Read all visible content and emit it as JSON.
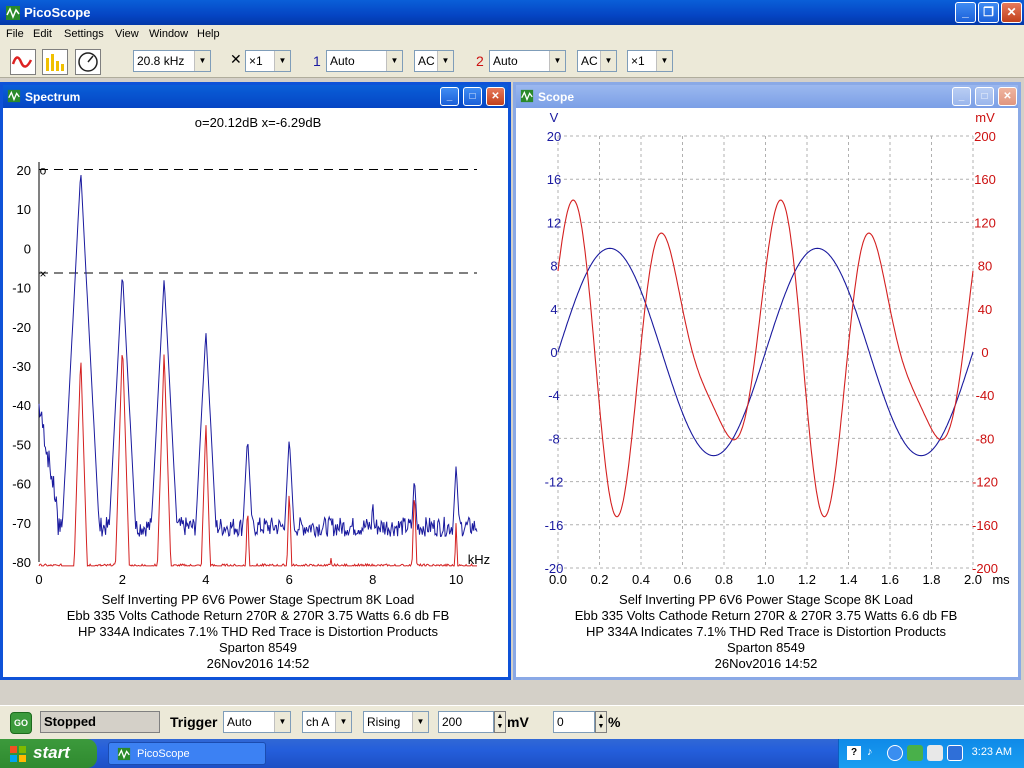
{
  "app": {
    "title": "PicoScope"
  },
  "menu": [
    "File",
    "Edit",
    "Settings",
    "View",
    "Window",
    "Help"
  ],
  "toolbar": {
    "timebase": "20.8 kHz",
    "x_mult": "×1",
    "ch1_label": "1",
    "ch1_range": "Auto",
    "ch1_coupling": "AC",
    "ch2_label": "2",
    "ch2_range": "Auto",
    "ch2_coupling": "AC",
    "ch2_mult": "×1"
  },
  "spectrum": {
    "title": "Spectrum",
    "readout": "o=20.12dB  x=-6.29dB",
    "x_unit": "kHz",
    "caption": [
      "Self Inverting PP 6V6 Power Stage Spectrum 8K Load",
      "Ebb 335 Volts Cathode Return 270R & 270R 3.75 Watts 6.6 db FB",
      "HP 334A Indicates 7.1% THD Red Trace is Distortion Products",
      "Sparton 8549",
      "26Nov2016  14:52"
    ]
  },
  "scope": {
    "title": "Scope",
    "y_left_unit": "V",
    "y_right_unit": "mV",
    "x_unit": "ms",
    "caption": [
      "Self Inverting PP 6V6 Power Stage Scope 8K Load",
      "Ebb 335 Volts Cathode Return 270R & 270R 3.75 Watts 6.6 db FB",
      "HP 334A Indicates 7.1% THD Red Trace is Distortion Products",
      "Sparton 8549",
      "26Nov2016  14:52"
    ]
  },
  "chart_data": [
    {
      "type": "line",
      "x_ticks": [
        0,
        2,
        4,
        6,
        8,
        10
      ],
      "y_ticks": [
        20,
        10,
        0,
        -10,
        -20,
        -30,
        -40,
        -50,
        -60,
        -70,
        -80
      ],
      "xlim": [
        0,
        10.5
      ],
      "ylim": [
        -80,
        20
      ],
      "cursor_levels": [
        20.12,
        -6.29
      ],
      "series": [
        {
          "color": "#1a1a9e",
          "peaks": [
            {
              "x": 1,
              "y": 20
            },
            {
              "x": 2,
              "y": -6
            },
            {
              "x": 3,
              "y": -7.5
            },
            {
              "x": 4,
              "y": -21
            },
            {
              "x": 5,
              "y": -48
            },
            {
              "x": 6,
              "y": -48
            },
            {
              "x": 7,
              "y": -69
            },
            {
              "x": 8,
              "y": -64
            },
            {
              "x": 9,
              "y": -58
            },
            {
              "x": 10,
              "y": -55
            }
          ],
          "floor": -71
        },
        {
          "color": "#d42020",
          "peaks": [
            {
              "x": 1,
              "y": -27
            },
            {
              "x": 2,
              "y": -24
            },
            {
              "x": 3,
              "y": -26
            },
            {
              "x": 4,
              "y": -44
            },
            {
              "x": 5,
              "y": -65
            },
            {
              "x": 6,
              "y": -61
            },
            {
              "x": 7,
              "y": -79
            },
            {
              "x": 8,
              "y": -79
            },
            {
              "x": 9,
              "y": -61
            },
            {
              "x": 10,
              "y": -69
            }
          ],
          "floor": -81
        }
      ]
    },
    {
      "type": "line",
      "x_ticks": [
        "0.0",
        "0.2",
        "0.4",
        "0.6",
        "0.8",
        "1.0",
        "1.2",
        "1.4",
        "1.6",
        "1.8",
        "2.0"
      ],
      "y_left_ticks": [
        20,
        16,
        12,
        8,
        4,
        0,
        -4,
        -8,
        -12,
        -16,
        -20
      ],
      "y_right_ticks": [
        200,
        160,
        120,
        80,
        40,
        0,
        -40,
        -80,
        -120,
        -160,
        -200
      ],
      "xlim": [
        0,
        2.0
      ],
      "ylim_left": [
        -20,
        20
      ],
      "ylim_right": [
        -200,
        200
      ],
      "series": [
        {
          "color": "#1a1a9e",
          "axis": "left",
          "amplitude_v": 9.6,
          "frequency_khz": 1.0
        },
        {
          "color": "#d42020",
          "axis": "right",
          "harmonics_mv": [
            {
              "n": 2,
              "amp": 110
            },
            {
              "n": 3,
              "amp": 45
            }
          ]
        }
      ]
    }
  ],
  "status": {
    "state": "Stopped",
    "trigger_label": "Trigger",
    "trigger_mode": "Auto",
    "trigger_channel": "ch A",
    "trigger_edge": "Rising",
    "trigger_level": "200",
    "level_unit": "mV",
    "pre_trigger": "0",
    "pct_unit": "%",
    "go": "GO"
  },
  "taskbar": {
    "start": "start",
    "item": "PicoScope",
    "clock": "3:23 AM"
  }
}
